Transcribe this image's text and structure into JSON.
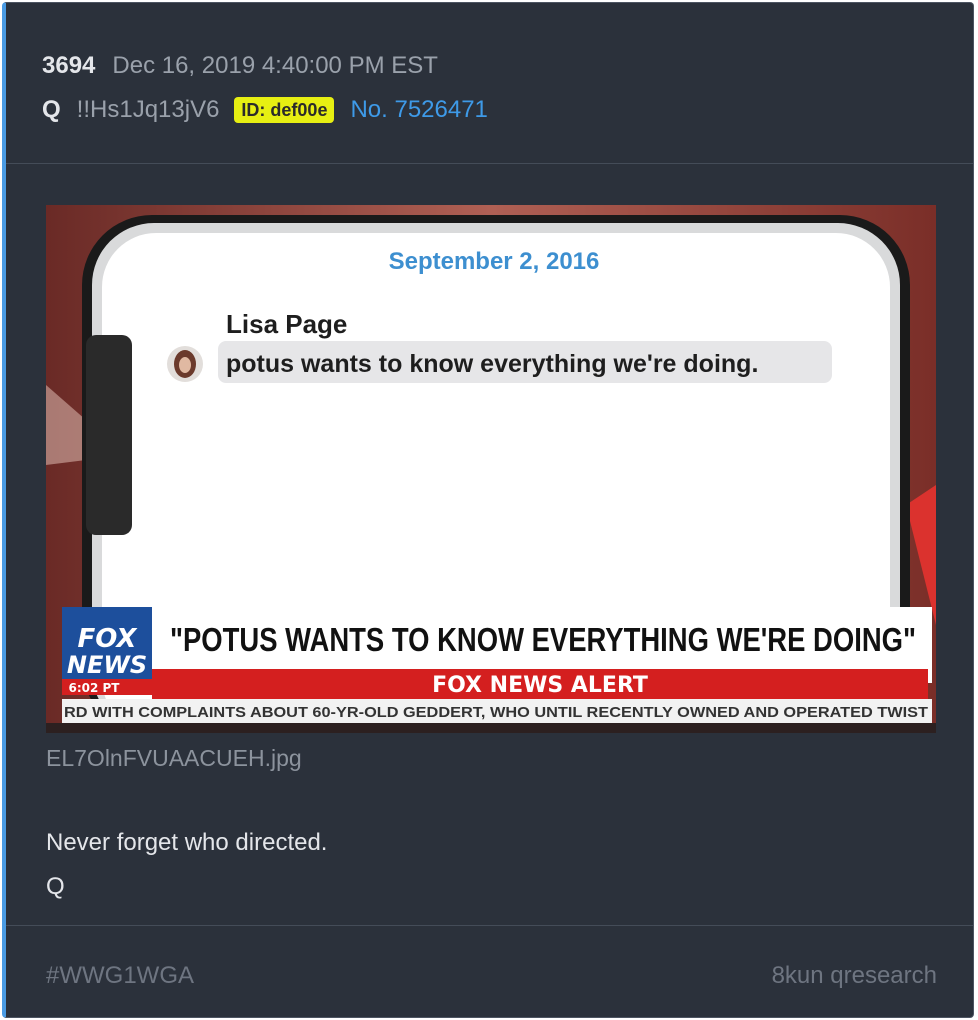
{
  "post": {
    "number": "3694",
    "date": "Dec 16, 2019 4:40:00 PM EST",
    "author": "Q",
    "tripcode": "!!Hs1Jq13jV6",
    "id_badge": "ID: def00e",
    "post_link": "No. 7526471"
  },
  "attachment": {
    "filename": "EL7OlnFVUAACUEH.jpg",
    "screen_date": "September 2, 2016",
    "sender": "Lisa Page",
    "message": "potus wants to know everything we're doing.",
    "logo_line1": "FOX",
    "logo_line2": "NEWS",
    "logo_time": "6:02 PT",
    "headline": "\"POTUS WANTS TO KNOW EVERYTHING WE'RE DOING\"",
    "alert": "FOX NEWS ALERT",
    "ticker": "RD WITH COMPLAINTS ABOUT 60-YR-OLD GEDDERT, WHO UNTIL RECENTLY OWNED AND OPERATED TWIST"
  },
  "body": {
    "line1": "Never forget who directed.",
    "line2": "Q"
  },
  "footer": {
    "hashtag": "#WWG1WGA",
    "source": "8kun qresearch"
  },
  "colors": {
    "card_bg": "#2b313b",
    "accent_border": "#4a9be3",
    "id_badge": "#e7ef12",
    "link": "#3e9ae8",
    "fox_red": "#d41f1f",
    "fox_blue": "#1d4f9c"
  }
}
